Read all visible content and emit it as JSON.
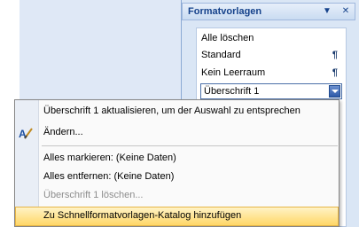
{
  "pane": {
    "title": "Formatvorlagen",
    "items": [
      {
        "label": "Alle löschen",
        "mark": ""
      },
      {
        "label": "Standard",
        "mark": "¶"
      },
      {
        "label": "Kein Leerraum",
        "mark": "¶"
      }
    ],
    "selected": "Überschrift 1"
  },
  "menu": {
    "items": [
      {
        "label": "Überschrift 1 aktualisieren, um der Auswahl zu entsprechen",
        "enabled": true
      },
      {
        "label": "Ändern...",
        "enabled": true,
        "icon": "edit-style-icon"
      },
      {
        "label": "Alles markieren: (Keine Daten)",
        "enabled": true
      },
      {
        "label": "Alles entfernen: (Keine Daten)",
        "enabled": true
      },
      {
        "label": "Überschrift 1 löschen...",
        "enabled": false
      },
      {
        "label": "Zu Schnellformatvorlagen-Katalog hinzufügen",
        "enabled": true,
        "highlighted": true
      }
    ]
  },
  "colors": {
    "pane_title": "#15428b",
    "highlight": "#ffd767",
    "disabled_text": "#8d8d8d"
  }
}
